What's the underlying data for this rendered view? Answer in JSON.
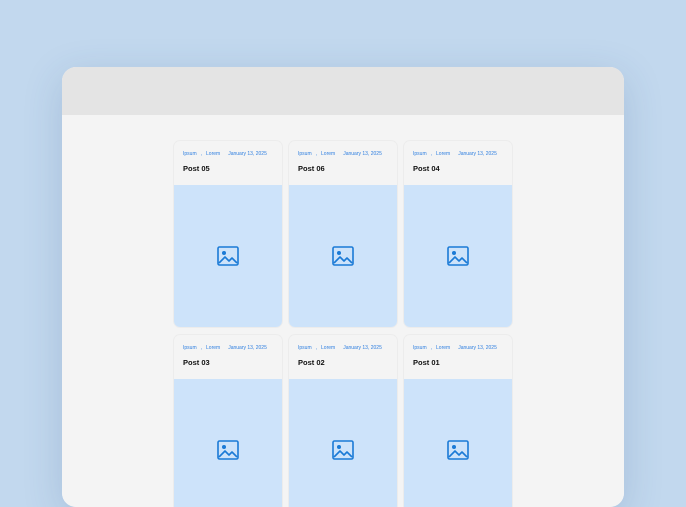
{
  "colors": {
    "background": "#c2d8ee",
    "window": "#f4f4f4",
    "titlebar": "#e4e4e4",
    "accent": "#2f7fe0",
    "thumbnail": "#cde3fa"
  },
  "posts": [
    {
      "title": "Post 05",
      "tag1": "Ipsum",
      "tag2": "Lorem",
      "date": "January 13, 2025",
      "thumbnail_icon": "image-icon"
    },
    {
      "title": "Post 06",
      "tag1": "Ipsum",
      "tag2": "Lorem",
      "date": "January 13, 2025",
      "thumbnail_icon": "image-icon"
    },
    {
      "title": "Post 04",
      "tag1": "Ipsum",
      "tag2": "Lorem",
      "date": "January 13, 2025",
      "thumbnail_icon": "image-icon"
    },
    {
      "title": "Post 03",
      "tag1": "Ipsum",
      "tag2": "Lorem",
      "date": "January 13, 2025",
      "thumbnail_icon": "image-icon"
    },
    {
      "title": "Post 02",
      "tag1": "Ipsum",
      "tag2": "Lorem",
      "date": "January 13, 2025",
      "thumbnail_icon": "image-icon"
    },
    {
      "title": "Post 01",
      "tag1": "Ipsum",
      "tag2": "Lorem",
      "date": "January 13, 2025",
      "thumbnail_icon": "image-icon"
    }
  ]
}
